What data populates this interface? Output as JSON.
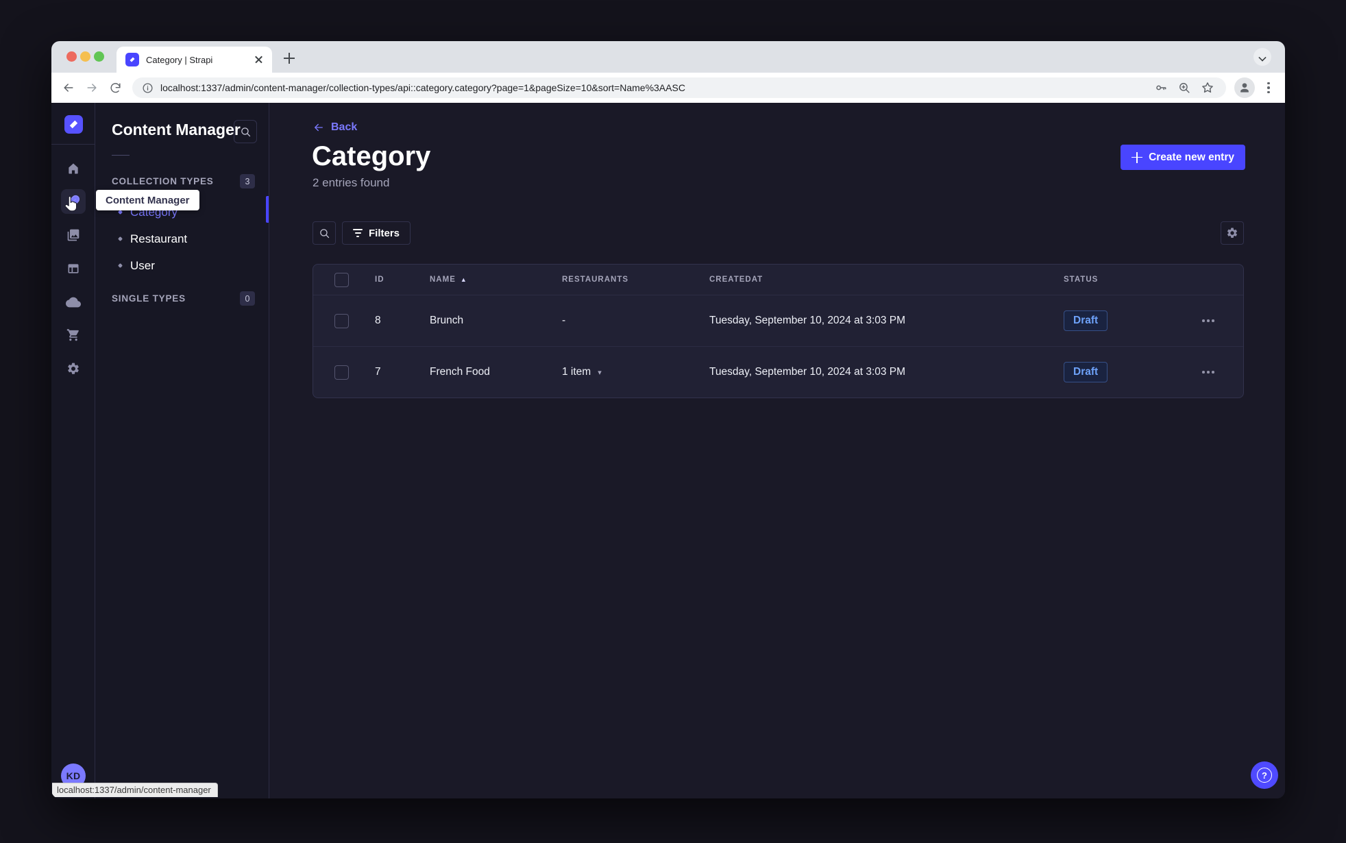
{
  "browser": {
    "tab_title": "Category | Strapi",
    "url": "localhost:1337/admin/content-manager/collection-types/api::category.category?page=1&pageSize=10&sort=Name%3AASC",
    "status_bubble": "localhost:1337/admin/content-manager"
  },
  "icons": {
    "sort_asc": "▲",
    "caret_down": "▾",
    "question": "?"
  },
  "rail": {
    "tooltip": "Content Manager",
    "avatar_initials": "KD",
    "items": [
      "home-icon",
      "content-manager-icon",
      "media-library-icon",
      "content-type-builder-icon",
      "cloud-icon",
      "marketplace-icon",
      "settings-icon"
    ]
  },
  "sidebar": {
    "title": "Content Manager",
    "collection_label": "COLLECTION TYPES",
    "collection_count": "3",
    "single_label": "SINGLE TYPES",
    "single_count": "0",
    "items": [
      {
        "label": "Category"
      },
      {
        "label": "Restaurant"
      },
      {
        "label": "User"
      }
    ]
  },
  "main": {
    "back": "Back",
    "title": "Category",
    "subtitle": "2 entries found",
    "create_button": "Create new entry",
    "filters": "Filters",
    "table": {
      "headers": {
        "id": "ID",
        "name": "NAME",
        "restaurants": "RESTAURANTS",
        "createdat": "CREATEDAT",
        "status": "STATUS"
      },
      "rows": [
        {
          "id": "8",
          "name": "Brunch",
          "restaurants": "-",
          "createdat": "Tuesday, September 10, 2024 at 3:03 PM",
          "status": "Draft"
        },
        {
          "id": "7",
          "name": "French Food",
          "restaurants": "1 item",
          "createdat": "Tuesday, September 10, 2024 at 3:03 PM",
          "status": "Draft"
        }
      ]
    }
  },
  "colors": {
    "brand": "#4945ff",
    "brand_light": "#7b79ff",
    "app_bg": "#181826",
    "panel_bg": "#212134",
    "border": "#32324d",
    "muted_text": "#a5a5ba",
    "draft_text": "#6ea2f9"
  }
}
